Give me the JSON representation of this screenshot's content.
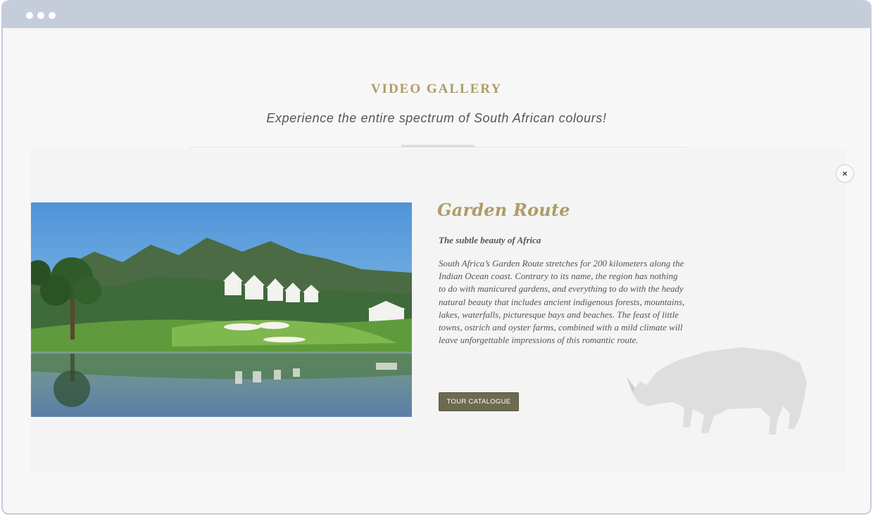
{
  "section": {
    "title": "VIDEO GALLERY",
    "subtitle": "Experience the entire spectrum of South African colours!"
  },
  "close": {
    "glyph": "×",
    "icon": "close-icon"
  },
  "card": {
    "title": "Garden Route",
    "subtitle": "The subtle beauty of Africa",
    "body": "South Africa’s Garden Route stretches for 200 kilometers along the Indian Ocean coast. Contrary to its name, the region has nothing to do with manicured gardens, and everything to do with the heady natural beauty that includes ancient indigenous forests, mountains, lakes, waterfalls, picturesque bays and beaches. The feast of little towns, ostrich and oyster farms, combined with a mild climate will leave unforgettable impressions of this romantic route.",
    "button_label": "TOUR CATALOGUE"
  },
  "colors": {
    "accent_gold": "#ae9b67",
    "button_bg": "#6e6a50",
    "frame": "#c5cddb"
  }
}
